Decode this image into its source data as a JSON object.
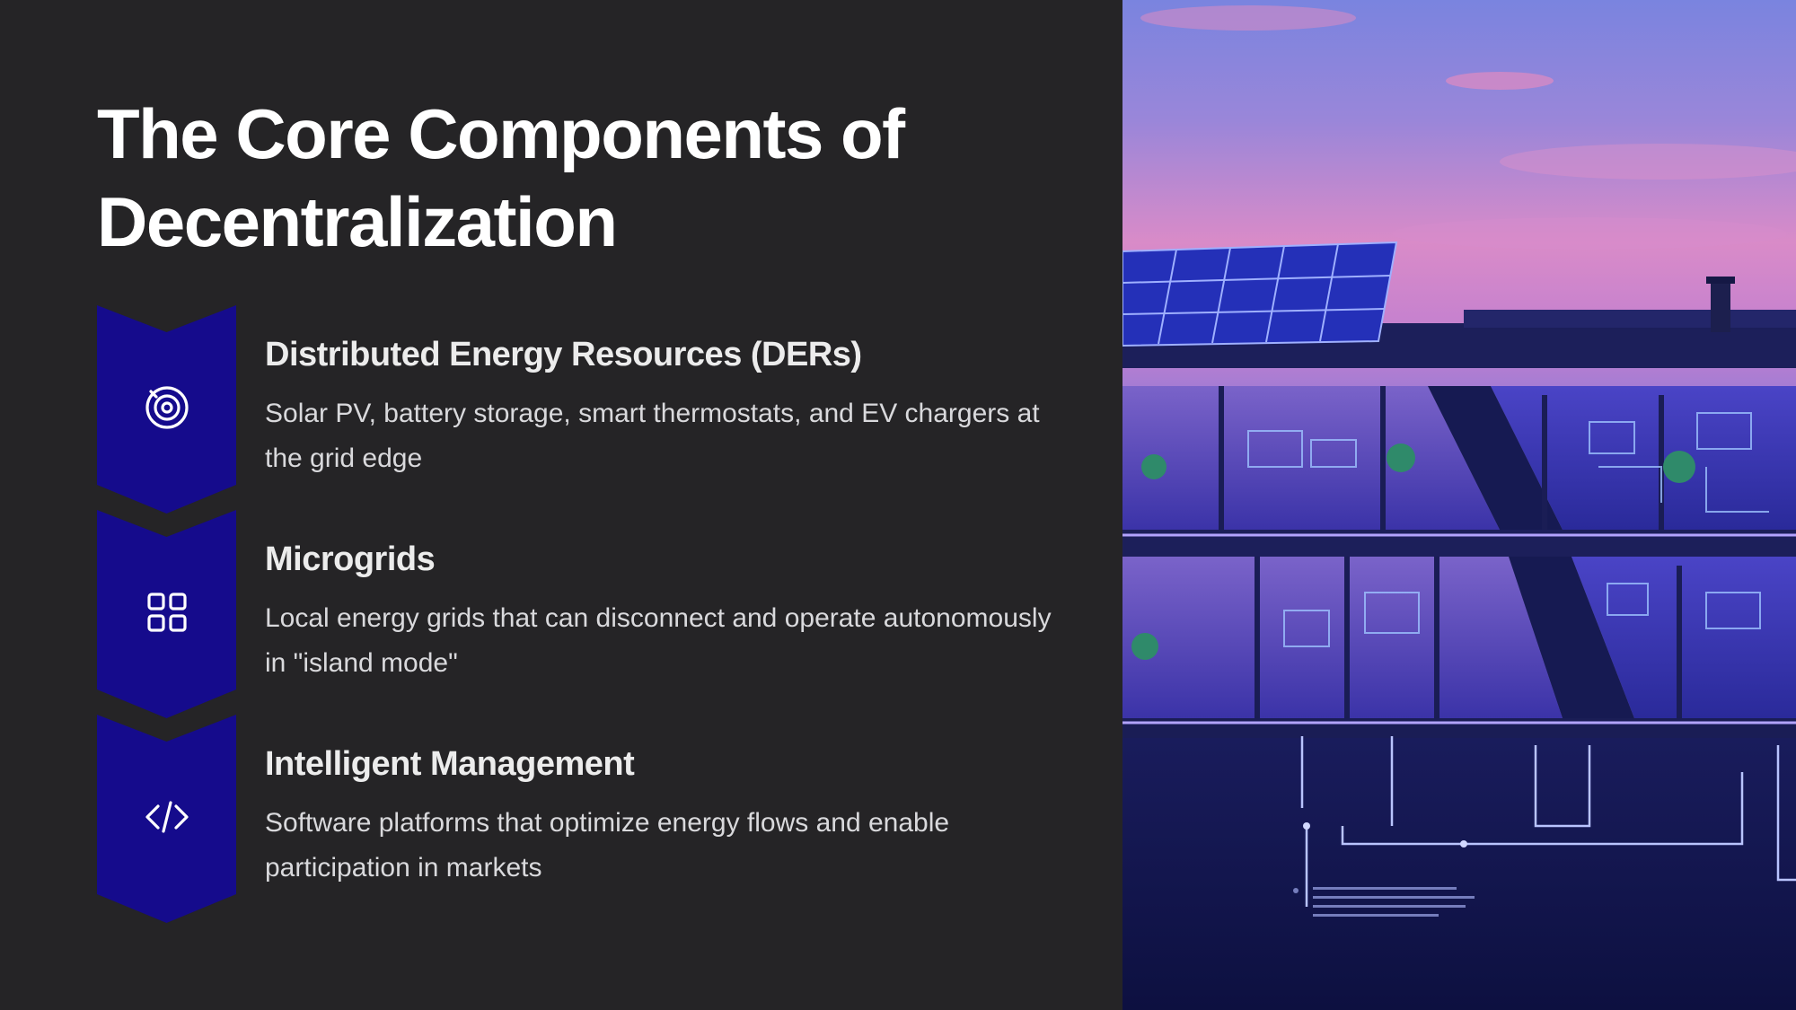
{
  "slide": {
    "title_line1": "The Core Components of",
    "title_line2": "Decentralization"
  },
  "items": [
    {
      "title": "Distributed Energy Resources (DERs)",
      "description": "Solar PV, battery storage, smart thermostats, and EV chargers at the grid edge",
      "icon": "target-rings-icon"
    },
    {
      "title": "Microgrids",
      "description": "Local energy grids that can disconnect and operate autonomously in \"island mode\"",
      "icon": "grid-squares-icon"
    },
    {
      "title": "Intelligent Management",
      "description": "Software platforms that optimize energy flows and enable participation in markets",
      "icon": "code-brackets-icon"
    }
  ],
  "colors": {
    "background": "#252426",
    "badge": "#150b8c",
    "title_text": "#ffffff",
    "body_text": "#d9d9dc"
  }
}
